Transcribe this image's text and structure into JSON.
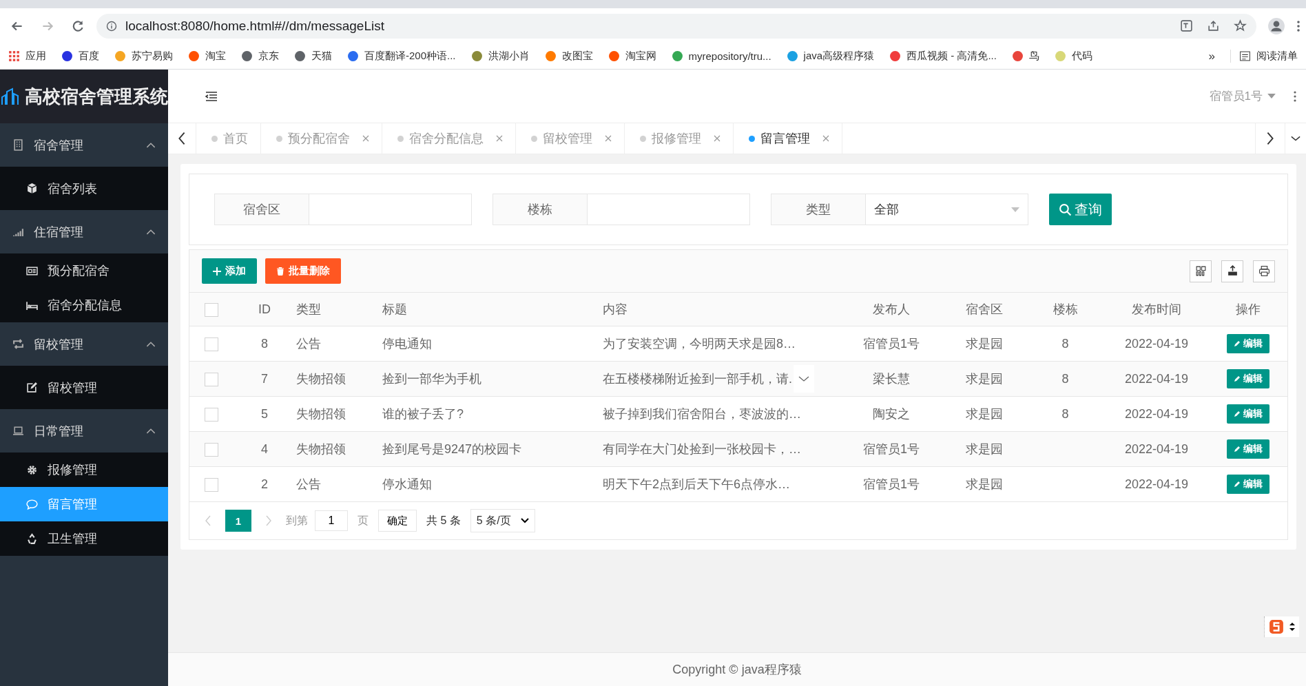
{
  "browser": {
    "url": "localhost:8080/home.html#//dm/messageList",
    "bookmarks": [
      {
        "label": "应用",
        "color": "#e8453c"
      },
      {
        "label": "百度",
        "color": "#2932e1"
      },
      {
        "label": "苏宁易购",
        "color": "#f5a623"
      },
      {
        "label": "淘宝",
        "color": "#ff5000"
      },
      {
        "label": "京东",
        "color": "#5f6368"
      },
      {
        "label": "天猫",
        "color": "#5f6368"
      },
      {
        "label": "百度翻译-200种语...",
        "color": "#2a6cf0"
      },
      {
        "label": "洪湖小肖",
        "color": "#8a8a3a"
      },
      {
        "label": "改图宝",
        "color": "#ff7a00"
      },
      {
        "label": "淘宝网",
        "color": "#ff5000"
      },
      {
        "label": "myrepository/tru...",
        "color": "#34a853"
      },
      {
        "label": "java高级程序猿",
        "color": "#1ba1e2"
      },
      {
        "label": "西瓜视频 - 高清免...",
        "color": "#f03c3c"
      },
      {
        "label": "鸟",
        "color": "#e8453c"
      },
      {
        "label": "代码",
        "color": "#d8d878"
      }
    ],
    "overflow": "»",
    "reading_list": "阅读清单"
  },
  "app": {
    "title": "高校宿舍管理系统",
    "user": "宿管员1号"
  },
  "sidebar": [
    {
      "label": "宿舍管理",
      "expanded": true,
      "children": [
        {
          "label": "宿舍列表",
          "selected": false
        }
      ]
    },
    {
      "label": "住宿管理",
      "expanded": true,
      "children": [
        {
          "label": "预分配宿舍",
          "selected": false
        },
        {
          "label": "宿舍分配信息",
          "selected": false
        }
      ]
    },
    {
      "label": "留校管理",
      "expanded": true,
      "children": [
        {
          "label": "留校管理",
          "selected": false
        }
      ]
    },
    {
      "label": "日常管理",
      "expanded": true,
      "children": [
        {
          "label": "报修管理",
          "selected": false
        },
        {
          "label": "留言管理",
          "selected": true
        },
        {
          "label": "卫生管理",
          "selected": false
        }
      ]
    }
  ],
  "tabs": [
    {
      "label": "首页",
      "selected": false,
      "closable": false
    },
    {
      "label": "预分配宿舍",
      "selected": false,
      "closable": true
    },
    {
      "label": "宿舍分配信息",
      "selected": false,
      "closable": true
    },
    {
      "label": "留校管理",
      "selected": false,
      "closable": true
    },
    {
      "label": "报修管理",
      "selected": false,
      "closable": true
    },
    {
      "label": "留言管理",
      "selected": true,
      "closable": true
    }
  ],
  "search": {
    "fields": [
      {
        "label": "宿舍区",
        "kind": "text"
      },
      {
        "label": "楼栋",
        "kind": "text"
      },
      {
        "label": "类型",
        "kind": "select",
        "value": "全部"
      }
    ],
    "button": "查询"
  },
  "toolbar": {
    "add": "添加",
    "delete": "批量删除"
  },
  "table": {
    "select_all": false,
    "columns": [
      "ID",
      "类型",
      "标题",
      "内容",
      "发布人",
      "宿舍区",
      "楼栋",
      "发布时间",
      "操作"
    ],
    "rows": [
      {
        "checked": false,
        "cells": [
          "8",
          "公告",
          "停电通知",
          "为了安装空调，今明两天求是园8…",
          "宿管员1号",
          "求是园",
          "8",
          "2022-04-19"
        ],
        "action": "编辑"
      },
      {
        "checked": false,
        "cells": [
          "7",
          "失物招领",
          "捡到一部华为手机",
          "在五楼楼梯附近捡到一部手机，请.",
          "梁长慧",
          "求是园",
          "8",
          "2022-04-19"
        ],
        "action": "编辑",
        "expander": true
      },
      {
        "checked": false,
        "cells": [
          "5",
          "失物招领",
          "谁的被子丢了?",
          "被子掉到我们宿舍阳台，枣波波的…",
          "陶安之",
          "求是园",
          "8",
          "2022-04-19"
        ],
        "action": "编辑"
      },
      {
        "checked": false,
        "cells": [
          "4",
          "失物招领",
          "捡到尾号是9247的校园卡",
          "有同学在大门处捡到一张校园卡，…",
          "宿管员1号",
          "求是园",
          "",
          "2022-04-19"
        ],
        "action": "编辑"
      },
      {
        "checked": false,
        "cells": [
          "2",
          "公告",
          "停水通知",
          "明天下午2点到后天下午6点停水…",
          "宿管员1号",
          "求是园",
          "",
          "2022-04-19"
        ],
        "action": "编辑"
      }
    ]
  },
  "pagination": {
    "page": "1",
    "goto_label": "到第",
    "goto_value": "1",
    "page_unit": "页",
    "confirm": "确定",
    "total": "共 5 条",
    "page_size": "5 条/页"
  },
  "footer": "Copyright © java程序猿"
}
